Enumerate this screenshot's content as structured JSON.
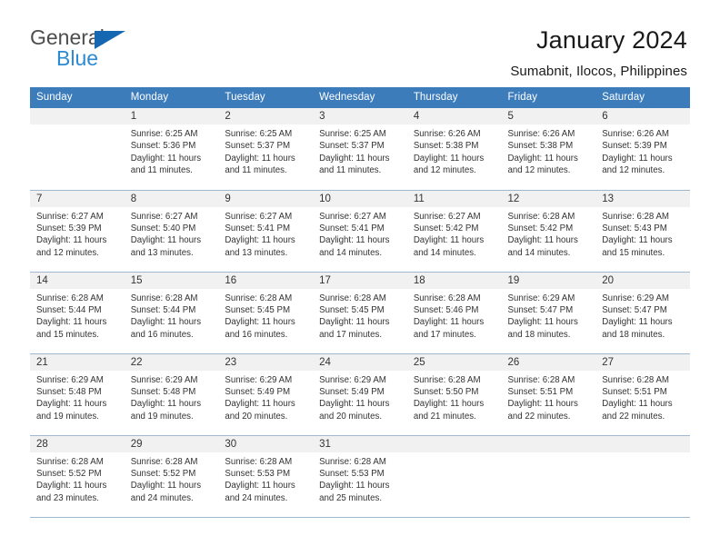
{
  "brand": {
    "name_top": "General",
    "name_bottom": "Blue",
    "accent_color": "#1567b2",
    "accent_color_light": "#2b8ad0"
  },
  "header": {
    "title": "January 2024",
    "subtitle": "Sumabnit, Ilocos, Philippines"
  },
  "calendar": {
    "header_bg": "#3d7cbb",
    "daynum_bg": "#f1f1f1",
    "border_color": "#9fb8d1",
    "weekday_headers": [
      "Sunday",
      "Monday",
      "Tuesday",
      "Wednesday",
      "Thursday",
      "Friday",
      "Saturday"
    ],
    "weeks": [
      [
        {
          "day": "",
          "empty": true,
          "sunrise": "",
          "sunset": "",
          "daylight1": "",
          "daylight2": ""
        },
        {
          "day": "1",
          "sunrise": "Sunrise: 6:25 AM",
          "sunset": "Sunset: 5:36 PM",
          "daylight1": "Daylight: 11 hours",
          "daylight2": "and 11 minutes."
        },
        {
          "day": "2",
          "sunrise": "Sunrise: 6:25 AM",
          "sunset": "Sunset: 5:37 PM",
          "daylight1": "Daylight: 11 hours",
          "daylight2": "and 11 minutes."
        },
        {
          "day": "3",
          "sunrise": "Sunrise: 6:25 AM",
          "sunset": "Sunset: 5:37 PM",
          "daylight1": "Daylight: 11 hours",
          "daylight2": "and 11 minutes."
        },
        {
          "day": "4",
          "sunrise": "Sunrise: 6:26 AM",
          "sunset": "Sunset: 5:38 PM",
          "daylight1": "Daylight: 11 hours",
          "daylight2": "and 12 minutes."
        },
        {
          "day": "5",
          "sunrise": "Sunrise: 6:26 AM",
          "sunset": "Sunset: 5:38 PM",
          "daylight1": "Daylight: 11 hours",
          "daylight2": "and 12 minutes."
        },
        {
          "day": "6",
          "sunrise": "Sunrise: 6:26 AM",
          "sunset": "Sunset: 5:39 PM",
          "daylight1": "Daylight: 11 hours",
          "daylight2": "and 12 minutes."
        }
      ],
      [
        {
          "day": "7",
          "sunrise": "Sunrise: 6:27 AM",
          "sunset": "Sunset: 5:39 PM",
          "daylight1": "Daylight: 11 hours",
          "daylight2": "and 12 minutes."
        },
        {
          "day": "8",
          "sunrise": "Sunrise: 6:27 AM",
          "sunset": "Sunset: 5:40 PM",
          "daylight1": "Daylight: 11 hours",
          "daylight2": "and 13 minutes."
        },
        {
          "day": "9",
          "sunrise": "Sunrise: 6:27 AM",
          "sunset": "Sunset: 5:41 PM",
          "daylight1": "Daylight: 11 hours",
          "daylight2": "and 13 minutes."
        },
        {
          "day": "10",
          "sunrise": "Sunrise: 6:27 AM",
          "sunset": "Sunset: 5:41 PM",
          "daylight1": "Daylight: 11 hours",
          "daylight2": "and 14 minutes."
        },
        {
          "day": "11",
          "sunrise": "Sunrise: 6:27 AM",
          "sunset": "Sunset: 5:42 PM",
          "daylight1": "Daylight: 11 hours",
          "daylight2": "and 14 minutes."
        },
        {
          "day": "12",
          "sunrise": "Sunrise: 6:28 AM",
          "sunset": "Sunset: 5:42 PM",
          "daylight1": "Daylight: 11 hours",
          "daylight2": "and 14 minutes."
        },
        {
          "day": "13",
          "sunrise": "Sunrise: 6:28 AM",
          "sunset": "Sunset: 5:43 PM",
          "daylight1": "Daylight: 11 hours",
          "daylight2": "and 15 minutes."
        }
      ],
      [
        {
          "day": "14",
          "sunrise": "Sunrise: 6:28 AM",
          "sunset": "Sunset: 5:44 PM",
          "daylight1": "Daylight: 11 hours",
          "daylight2": "and 15 minutes."
        },
        {
          "day": "15",
          "sunrise": "Sunrise: 6:28 AM",
          "sunset": "Sunset: 5:44 PM",
          "daylight1": "Daylight: 11 hours",
          "daylight2": "and 16 minutes."
        },
        {
          "day": "16",
          "sunrise": "Sunrise: 6:28 AM",
          "sunset": "Sunset: 5:45 PM",
          "daylight1": "Daylight: 11 hours",
          "daylight2": "and 16 minutes."
        },
        {
          "day": "17",
          "sunrise": "Sunrise: 6:28 AM",
          "sunset": "Sunset: 5:45 PM",
          "daylight1": "Daylight: 11 hours",
          "daylight2": "and 17 minutes."
        },
        {
          "day": "18",
          "sunrise": "Sunrise: 6:28 AM",
          "sunset": "Sunset: 5:46 PM",
          "daylight1": "Daylight: 11 hours",
          "daylight2": "and 17 minutes."
        },
        {
          "day": "19",
          "sunrise": "Sunrise: 6:29 AM",
          "sunset": "Sunset: 5:47 PM",
          "daylight1": "Daylight: 11 hours",
          "daylight2": "and 18 minutes."
        },
        {
          "day": "20",
          "sunrise": "Sunrise: 6:29 AM",
          "sunset": "Sunset: 5:47 PM",
          "daylight1": "Daylight: 11 hours",
          "daylight2": "and 18 minutes."
        }
      ],
      [
        {
          "day": "21",
          "sunrise": "Sunrise: 6:29 AM",
          "sunset": "Sunset: 5:48 PM",
          "daylight1": "Daylight: 11 hours",
          "daylight2": "and 19 minutes."
        },
        {
          "day": "22",
          "sunrise": "Sunrise: 6:29 AM",
          "sunset": "Sunset: 5:48 PM",
          "daylight1": "Daylight: 11 hours",
          "daylight2": "and 19 minutes."
        },
        {
          "day": "23",
          "sunrise": "Sunrise: 6:29 AM",
          "sunset": "Sunset: 5:49 PM",
          "daylight1": "Daylight: 11 hours",
          "daylight2": "and 20 minutes."
        },
        {
          "day": "24",
          "sunrise": "Sunrise: 6:29 AM",
          "sunset": "Sunset: 5:49 PM",
          "daylight1": "Daylight: 11 hours",
          "daylight2": "and 20 minutes."
        },
        {
          "day": "25",
          "sunrise": "Sunrise: 6:28 AM",
          "sunset": "Sunset: 5:50 PM",
          "daylight1": "Daylight: 11 hours",
          "daylight2": "and 21 minutes."
        },
        {
          "day": "26",
          "sunrise": "Sunrise: 6:28 AM",
          "sunset": "Sunset: 5:51 PM",
          "daylight1": "Daylight: 11 hours",
          "daylight2": "and 22 minutes."
        },
        {
          "day": "27",
          "sunrise": "Sunrise: 6:28 AM",
          "sunset": "Sunset: 5:51 PM",
          "daylight1": "Daylight: 11 hours",
          "daylight2": "and 22 minutes."
        }
      ],
      [
        {
          "day": "28",
          "sunrise": "Sunrise: 6:28 AM",
          "sunset": "Sunset: 5:52 PM",
          "daylight1": "Daylight: 11 hours",
          "daylight2": "and 23 minutes."
        },
        {
          "day": "29",
          "sunrise": "Sunrise: 6:28 AM",
          "sunset": "Sunset: 5:52 PM",
          "daylight1": "Daylight: 11 hours",
          "daylight2": "and 24 minutes."
        },
        {
          "day": "30",
          "sunrise": "Sunrise: 6:28 AM",
          "sunset": "Sunset: 5:53 PM",
          "daylight1": "Daylight: 11 hours",
          "daylight2": "and 24 minutes."
        },
        {
          "day": "31",
          "sunrise": "Sunrise: 6:28 AM",
          "sunset": "Sunset: 5:53 PM",
          "daylight1": "Daylight: 11 hours",
          "daylight2": "and 25 minutes."
        },
        {
          "day": "",
          "empty": true,
          "sunrise": "",
          "sunset": "",
          "daylight1": "",
          "daylight2": ""
        },
        {
          "day": "",
          "empty": true,
          "sunrise": "",
          "sunset": "",
          "daylight1": "",
          "daylight2": ""
        },
        {
          "day": "",
          "empty": true,
          "sunrise": "",
          "sunset": "",
          "daylight1": "",
          "daylight2": ""
        }
      ]
    ]
  }
}
